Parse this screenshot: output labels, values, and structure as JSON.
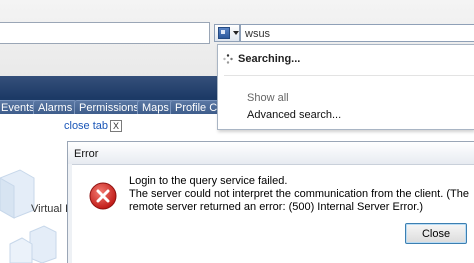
{
  "search": {
    "query": "wsus",
    "status": "Searching...",
    "show_all": "Show all",
    "advanced": "Advanced search..."
  },
  "tabs": [
    {
      "label": "Events"
    },
    {
      "label": "Alarms"
    },
    {
      "label": "Permissions"
    },
    {
      "label": "Maps"
    },
    {
      "label": "Profile Co"
    }
  ],
  "close_tab": {
    "label": "close tab",
    "x": "X"
  },
  "background": {
    "virtual_label": "Virtual I"
  },
  "dialog": {
    "title": "Error",
    "message_lines": [
      "Login to the query service failed.",
      "The server could not interpret the communication from the client. (The",
      "remote server returned an error: (500) Internal Server Error.)"
    ],
    "close_label": "Close"
  },
  "colors": {
    "error_red": "#d2231f",
    "link_blue": "#1a56b8",
    "nav_dark": "#1c3a66",
    "button_border": "#3c7fb1"
  }
}
